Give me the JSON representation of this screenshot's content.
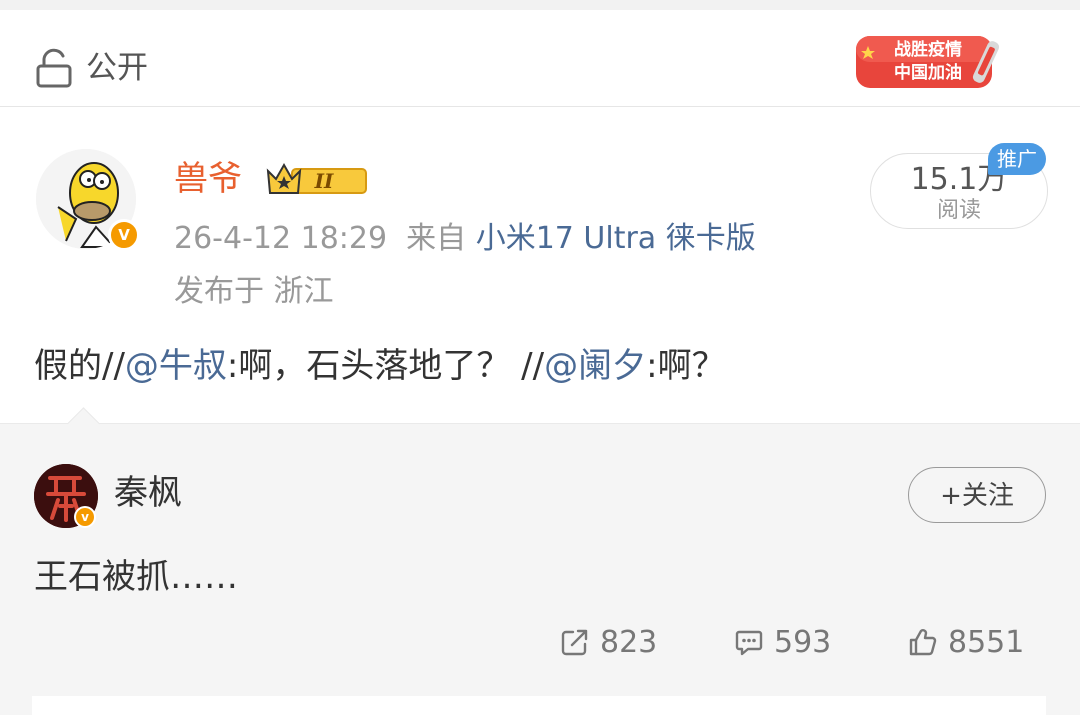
{
  "header": {
    "visibility_label": "公开",
    "campaign_line1": "战胜疫情",
    "campaign_line2": "中国加油"
  },
  "post": {
    "author": "兽爷",
    "level_badge": "II",
    "timestamp": "26-4-12 18:29",
    "source_prefix": "来自",
    "device": "小米17 Ultra 徕卡版",
    "location": "发布于 浙江",
    "read_count": "15.1万",
    "read_label": "阅读",
    "promo_tag": "推广",
    "verify_mark": "V",
    "text_parts": {
      "p1": "假的//",
      "m1": "@牛叔",
      "p2": ":啊，石头落地了？ //",
      "m2": "@阑夕",
      "p3": ":啊？"
    }
  },
  "retweet": {
    "author": "秦枫",
    "follow_label": "+关注",
    "text": "王石被抓……",
    "repost_count": "823",
    "comment_count": "593",
    "like_count": "8551",
    "verify_mark": "v"
  },
  "colors": {
    "username": "#e8602f",
    "link": "#4a6a95",
    "promo": "#4b9ae3",
    "verify": "#f59a00",
    "campaign": "#e8453c"
  }
}
